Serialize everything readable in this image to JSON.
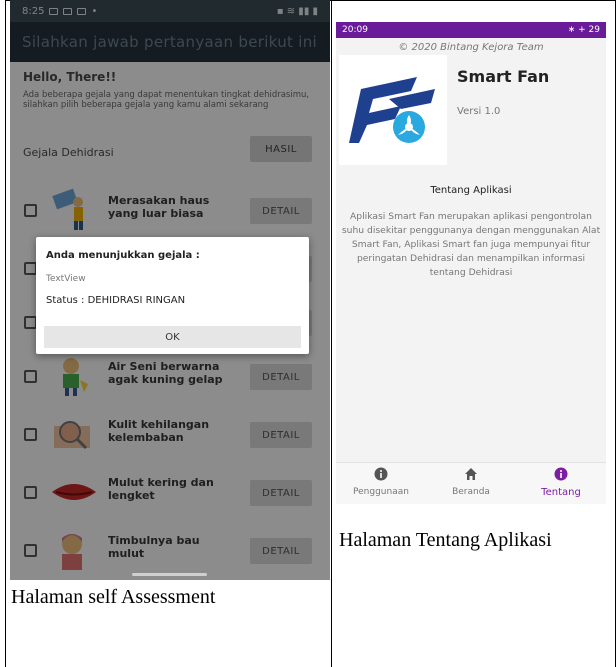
{
  "left": {
    "status_time": "8:25",
    "app_title": "Silahkan jawab pertanyaan berikut ini",
    "greeting": "Hello, There!!",
    "intro": "Ada beberapa gejala yang dapat menentukan tingkat dehidrasimu, silahkan pilih beberapa gejala yang kamu alami sekarang",
    "section_title": "Gejala Dehidrasi",
    "hasil_label": "HASIL",
    "detail_label": "DETAIL",
    "symptoms": [
      "Merasakan haus yang luar biasa",
      "",
      "",
      "Air Seni berwarna agak kuning gelap",
      "Kulit kehilangan kelembaban",
      "Mulut kering dan lengket",
      "Timbulnya bau mulut"
    ],
    "dialog": {
      "title": "Anda menunjukkan gejala :",
      "placeholder": "TextView",
      "status": "Status : DEHIDRASI RINGAN",
      "ok": "OK"
    },
    "caption": "Halaman self Assessment"
  },
  "right": {
    "status_time": "20:09",
    "status_battery": "29",
    "copyright": "© 2020 Bintang Kejora Team",
    "app_name": "Smart Fan",
    "version": "Versi 1.0",
    "about_title": "Tentang Aplikasi",
    "about_text": "Aplikasi Smart Fan merupakan aplikasi pengontrolan suhu disekitar penggunanya dengan menggunakan Alat Smart Fan, Aplikasi Smart fan juga mempunyai fitur peringatan Dehidrasi dan menampilkan informasi tentang Dehidrasi",
    "nav": [
      "Penggunaan",
      "Beranda",
      "Tentang"
    ],
    "active_tab": "Tentang",
    "accent": "#7b1fa2",
    "caption": "Halaman Tentang Aplikasi"
  }
}
